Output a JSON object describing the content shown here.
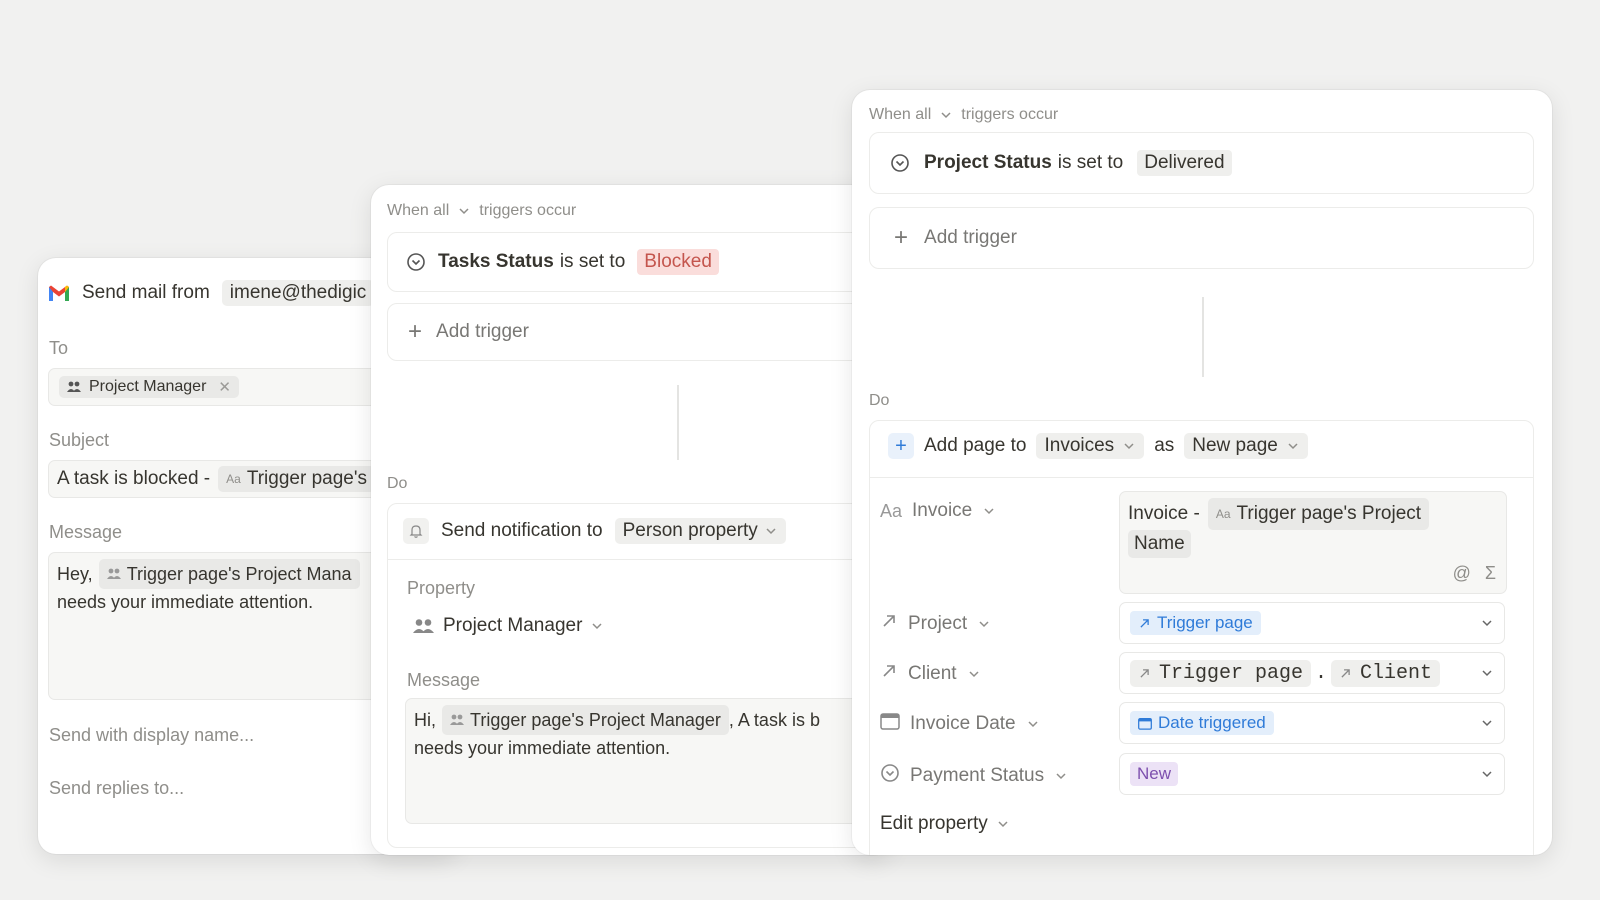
{
  "card_mail": {
    "send_label": "Send mail from",
    "sender": "imene@thedigic",
    "to_label": "To",
    "to_chip": "Project Manager",
    "subject_label": "Subject",
    "subject_prefix": "A task is blocked -",
    "subject_chip": "Trigger page's",
    "message_label": "Message",
    "message_greeting": "Hey,",
    "message_chip": "Trigger page's Project Mana",
    "message_line2": "needs your immediate attention.",
    "display_name_placeholder": "Send with display name...",
    "replies_placeholder": "Send replies to..."
  },
  "card_notify": {
    "when_all": "When all",
    "triggers_occur": "triggers occur",
    "trigger_prop": "Tasks Status",
    "trigger_verb": "is set to",
    "trigger_value": "Blocked",
    "add_trigger": "Add trigger",
    "do_label": "Do",
    "action_label": "Send notification to",
    "action_target": "Person property",
    "property_label": "Property",
    "property_value": "Project Manager",
    "message_label": "Message",
    "message_greeting": "Hi,",
    "message_chip": "Trigger page's Project Manager",
    "message_tail": ", A task is b",
    "message_line2": "needs your immediate attention."
  },
  "card_page": {
    "when_all": "When all",
    "triggers_occur": "triggers occur",
    "trigger_prop": "Project Status",
    "trigger_verb": "is set to",
    "trigger_value": "Delivered",
    "add_trigger": "Add trigger",
    "do_label": "Do",
    "action_label": "Add page to",
    "database": "Invoices",
    "as_label": "as",
    "page_type": "New page",
    "properties": {
      "invoice": {
        "name": "Invoice",
        "value_prefix": "Invoice -",
        "value_chip_line1": "Trigger page's Project",
        "value_chip_line2": "Name"
      },
      "project": {
        "name": "Project",
        "value": "Trigger page"
      },
      "client": {
        "name": "Client",
        "value_a": "Trigger page",
        "dot": ".",
        "value_b": "Client"
      },
      "invoice_date": {
        "name": "Invoice Date",
        "value": "Date triggered"
      },
      "payment_status": {
        "name": "Payment Status",
        "value": "New"
      }
    },
    "edit_property": "Edit property"
  },
  "colors": {
    "red_tag_bg": "#fadddb",
    "red_tag_text": "#c4554d",
    "blue_tag_bg": "#e3eefb",
    "blue_tag_text": "#2f7bd8",
    "purple_tag_bg": "#ece2f6",
    "purple_tag_text": "#7d4fae",
    "gmail_red": "#ea4335"
  }
}
